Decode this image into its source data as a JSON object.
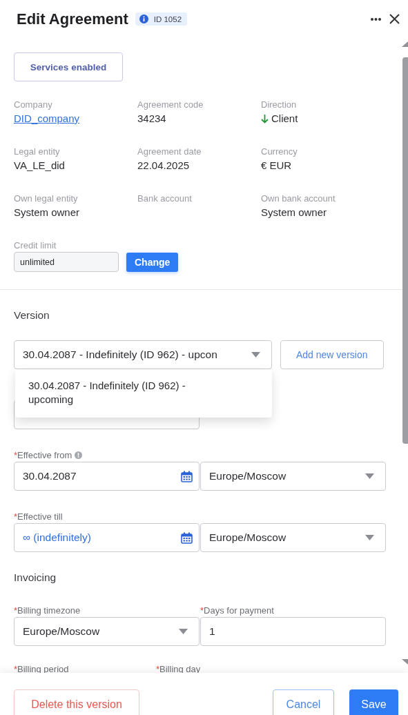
{
  "header": {
    "title": "Edit Agreement",
    "id_badge": "ID 1052"
  },
  "services_button": "Services enabled",
  "info": [
    {
      "label": "Company",
      "value": "DID_company",
      "kind": "link"
    },
    {
      "label": "Agreement code",
      "value": "34234",
      "kind": "text"
    },
    {
      "label": "Direction",
      "value": "Client",
      "kind": "direction"
    },
    {
      "label": "Legal entity",
      "value": "VA_LE_did",
      "kind": "text"
    },
    {
      "label": "Agreement date",
      "value": "22.04.2025",
      "kind": "text"
    },
    {
      "label": "Currency",
      "value": "€ EUR",
      "kind": "text"
    },
    {
      "label": "Own legal entity",
      "value": "System owner",
      "kind": "text"
    },
    {
      "label": "Bank account",
      "kind": "text"
    },
    {
      "label": "Own bank account",
      "value": "System owner",
      "kind": "text"
    }
  ],
  "credit_limit": {
    "label": "Credit limit",
    "value": "unlimited",
    "button": "Change"
  },
  "required_mark": "*",
  "version": {
    "label": "Version",
    "value": "30.04.2087 - Indefinitely (ID 962) - upcon",
    "add_button": "Add new version",
    "options": [
      {
        "label": "30.04.2087 - Indefinitely (ID 962) - upcoming",
        "selected": false
      }
    ]
  },
  "effective_from": {
    "label": "Effective from",
    "required": true,
    "info": true,
    "date": "30.04.2087",
    "indefinite": false,
    "timezone": "Europe/Moscow"
  },
  "effective_till": {
    "label": "Effective till",
    "required": true,
    "date": "∞ (indefinitely)",
    "indefinite": true,
    "timezone": "Europe/Moscow"
  },
  "invoicing": {
    "title": "Invoicing",
    "billing_timezone": {
      "label": "Billing timezone",
      "required": true,
      "value": "Europe/Moscow"
    },
    "days_for_payment": {
      "label": "Days for payment",
      "required": true,
      "value": "1"
    },
    "billing_period": {
      "label": "Billing period",
      "required": true
    },
    "billing_day": {
      "label": "Billing day",
      "required": true
    }
  },
  "footer": {
    "delete": "Delete this version",
    "cancel": "Cancel",
    "save": "Save"
  }
}
